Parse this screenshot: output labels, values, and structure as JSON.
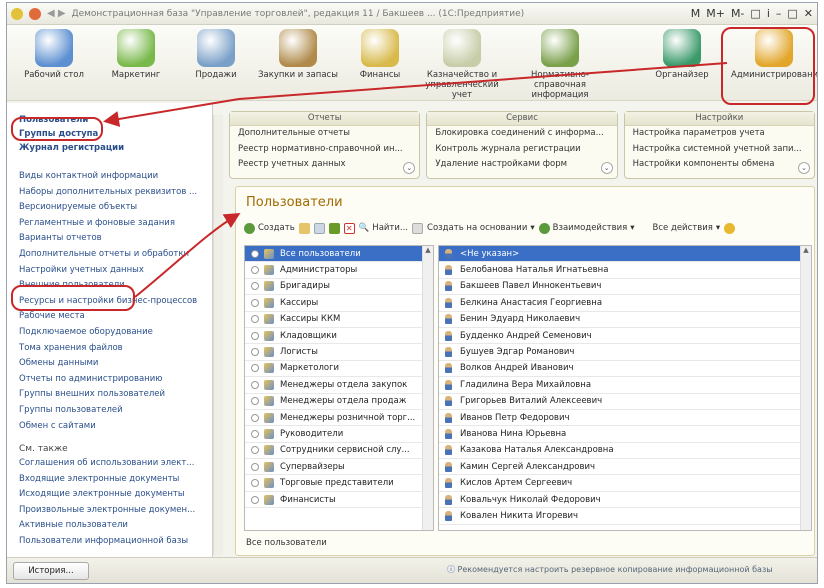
{
  "window": {
    "title": "Демонстрационная база \"Управление торговлей\", редакция 11 / Бакшеев ... (1С:Предприятие)",
    "controls": [
      "M",
      "M+",
      "M-",
      "□",
      "i",
      "–",
      "□",
      "✕"
    ]
  },
  "sections": [
    {
      "label": "Рабочий стол"
    },
    {
      "label": "Маркетинг"
    },
    {
      "label": "Продажи"
    },
    {
      "label": "Закупки и запасы"
    },
    {
      "label": "Финансы"
    },
    {
      "label": "Казначейство и управленческий учет"
    },
    {
      "label": "Нормативно-справочная информация"
    },
    {
      "label": "Органайзер"
    },
    {
      "label": "Администрирование"
    }
  ],
  "nav": {
    "bold": [
      "Пользователи",
      "Группы доступа",
      "Журнал регистрации"
    ],
    "items": [
      "Виды контактной информации",
      "Наборы дополнительных реквизитов ...",
      "Версионируемые объекты",
      "Регламентные и фоновые задания",
      "Варианты отчетов",
      "Дополнительные отчеты и обработки",
      "Настройки учетных данных",
      "Внешние пользователи",
      "Ресурсы и настройки бизнес-процессов",
      "Рабочие места",
      "Подключаемое оборудование",
      "Тома хранения файлов",
      "Обмены данными",
      "Отчеты по администрированию",
      "Группы внешних пользователей",
      "Группы пользователей",
      "Обмен с сайтами"
    ],
    "heading": "См. также",
    "see_also": [
      "Соглашения об использовании элект...",
      "Входящие электронные документы",
      "Исходящие электронные документы",
      "Произвольные электронные докумен...",
      "Активные пользователи",
      "Пользователи информационной базы"
    ]
  },
  "panels": [
    {
      "title": "Отчеты",
      "items": [
        "Дополнительные отчеты",
        "Реестр нормативно-справочной ин...",
        "Реестр учетных данных"
      ]
    },
    {
      "title": "Сервис",
      "items": [
        "Блокировка соединений с информа...",
        "Контроль журнала регистрации",
        "Удаление настройками форм"
      ]
    },
    {
      "title": "Настройки",
      "items": [
        "Настройка параметров учета",
        "Настройка системной учетной запи...",
        "Настройки компоненты обмена"
      ]
    }
  ],
  "content": {
    "title": "Пользователи",
    "toolbar": {
      "create": "Создать",
      "find": "Найти...",
      "create_based": "Создать на основании",
      "interactions": "Взаимодействия",
      "all_actions": "Все действия"
    },
    "groups": [
      "Все пользователи",
      "Администраторы",
      "Бригадиры",
      "Кассиры",
      "Кассиры ККМ",
      "Кладовщики",
      "Логисты",
      "Маркетологи",
      "Менеджеры отдела закупок",
      "Менеджеры отдела продаж",
      "Менеджеры розничной торг...",
      "Руководители",
      "Сотрудники сервисной слу...",
      "Супервайзеры",
      "Торговые представители",
      "Финансисты"
    ],
    "users": [
      "<Не указан>",
      "Белобанова Наталья Игнатьевна",
      "Бакшеев Павел Иннокентьевич",
      "Белкина Анастасия Георгиевна",
      "Бенин Эдуард Николаевич",
      "Будденко Андрей Семенович",
      "Бушуев Эдгар Романович",
      "Волков Андрей Иванович",
      "Гладилина Вера Михайловна",
      "Григорьев Виталий Алексеевич",
      "Иванов Петр Федорович",
      "Иванова Нина Юрьевна",
      "Казакова Наталья Александровна",
      "Камин Сергей Александрович",
      "Кислов Артем Сергеевич",
      "Ковальчук Николай Федорович",
      "Ковален Никита Игоревич"
    ],
    "caption": "Все пользователи"
  },
  "statusbar": {
    "history": "История...",
    "backup": "Рекомендуется настроить резервное копирование информационной базы"
  }
}
